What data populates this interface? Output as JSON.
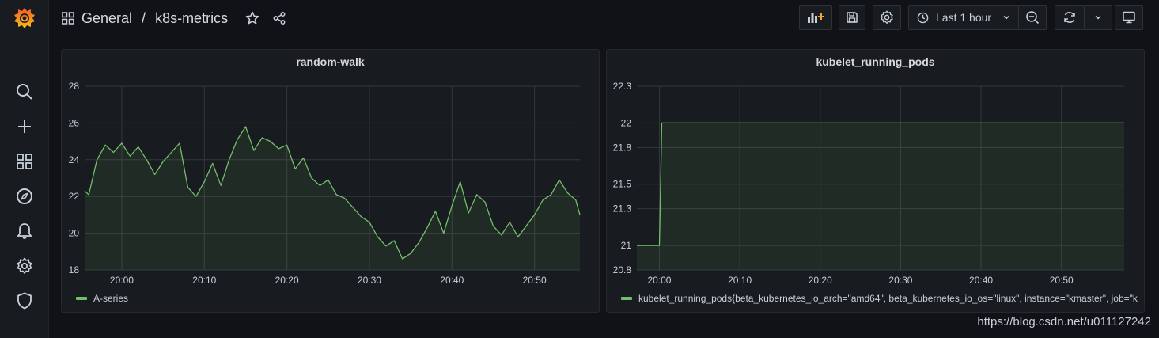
{
  "colors": {
    "accent_green": "#73bf69",
    "grid": "#34373c",
    "panel_bg": "#181b1f",
    "page_bg": "#111217"
  },
  "sidebar": {
    "logo": "grafana-logo-icon",
    "items": [
      {
        "name": "search-icon"
      },
      {
        "name": "plus-icon"
      },
      {
        "name": "dashboards-icon"
      },
      {
        "name": "explore-compass-icon"
      },
      {
        "name": "alerting-bell-icon"
      },
      {
        "name": "configuration-gear-icon"
      },
      {
        "name": "server-admin-shield-icon"
      }
    ]
  },
  "header": {
    "folder": "General",
    "separator": "/",
    "dashboard": "k8s-metrics",
    "time_range_label": "Last 1 hour"
  },
  "panels": {
    "left": {
      "title": "random-walk",
      "legend": "A-series"
    },
    "right": {
      "title": "kubelet_running_pods",
      "legend": "kubelet_running_pods{beta_kubernetes_io_arch=\"amd64\", beta_kubernetes_io_os=\"linux\", instance=\"kmaster\", job=\"kub"
    }
  },
  "watermark": "https://blog.csdn.net/u011127242",
  "chart_data": [
    {
      "type": "area",
      "title": "random-walk",
      "x_ticks": [
        "20:00",
        "20:10",
        "20:20",
        "20:30",
        "20:40",
        "20:50"
      ],
      "y_ticks": [
        "18",
        "20",
        "22",
        "24",
        "26",
        "28"
      ],
      "ylim": [
        18,
        28
      ],
      "xlim_minutes": [
        -4.5,
        55.5
      ],
      "grid": true,
      "legend_position": "bottom-left",
      "series": [
        {
          "name": "A-series",
          "color": "#73bf69",
          "x_minutes": [
            -4.5,
            -4,
            -3,
            -2,
            -1,
            0,
            1,
            2,
            3,
            4,
            5,
            6,
            7,
            8,
            9,
            10,
            11,
            12,
            13,
            14,
            15,
            16,
            17,
            18,
            19,
            20,
            21,
            22,
            23,
            24,
            25,
            26,
            27,
            28,
            29,
            30,
            31,
            32,
            33,
            34,
            35,
            36,
            37,
            38,
            39,
            40,
            41,
            42,
            43,
            44,
            45,
            46,
            47,
            48,
            49,
            50,
            51,
            52,
            53,
            54,
            55,
            55.5
          ],
          "values": [
            22.3,
            22.1,
            24.0,
            24.8,
            24.4,
            24.9,
            24.2,
            24.7,
            24.0,
            23.2,
            23.9,
            24.4,
            24.9,
            22.5,
            22.0,
            22.8,
            23.8,
            22.6,
            24.0,
            25.1,
            25.8,
            24.5,
            25.2,
            25.0,
            24.6,
            24.8,
            23.5,
            24.1,
            23.0,
            22.6,
            22.9,
            22.1,
            21.9,
            21.4,
            20.9,
            20.6,
            19.8,
            19.3,
            19.6,
            18.6,
            18.9,
            19.5,
            20.3,
            21.2,
            20.0,
            21.5,
            22.8,
            21.1,
            22.1,
            21.7,
            20.4,
            19.9,
            20.6,
            19.8,
            20.4,
            21.0,
            21.8,
            22.1,
            22.9,
            22.2,
            21.8,
            21.0
          ]
        }
      ]
    },
    {
      "type": "area",
      "title": "kubelet_running_pods",
      "x_ticks": [
        "20:00",
        "20:10",
        "20:20",
        "20:30",
        "20:40",
        "20:50"
      ],
      "y_ticks": [
        "20.8",
        "21",
        "21.3",
        "21.5",
        "21.8",
        "22",
        "22.3"
      ],
      "ylim": [
        20.8,
        22.3
      ],
      "xlim_minutes": [
        -2.8,
        57.8
      ],
      "grid": true,
      "legend_position": "bottom-left",
      "series": [
        {
          "name": "kubelet_running_pods{beta_kubernetes_io_arch=\"amd64\", beta_kubernetes_io_os=\"linux\", instance=\"kmaster\", job=\"kub",
          "color": "#73bf69",
          "x_minutes": [
            -2.8,
            0,
            0.3,
            57.8
          ],
          "values": [
            21,
            21,
            22,
            22
          ]
        }
      ]
    }
  ]
}
